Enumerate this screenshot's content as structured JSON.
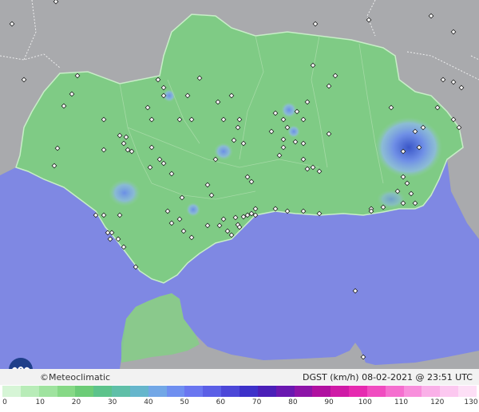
{
  "footer": {
    "copyright": "©Meteoclimatic",
    "product": "DGST (km/h)   08-02-2021 @ 23:51 UTC"
  },
  "scale": {
    "ticks": [
      "0",
      "10",
      "20",
      "30",
      "40",
      "50",
      "60",
      "70",
      "80",
      "90",
      "100",
      "110",
      "120",
      "130"
    ],
    "colors": [
      "#d6f5d6",
      "#b8ecb8",
      "#9fe39f",
      "#86d986",
      "#6ccc77",
      "#5cc38b",
      "#5fbfa8",
      "#66b6cc",
      "#72a7e6",
      "#6f8ff0",
      "#6a76f0",
      "#5b5fe6",
      "#4c47d8",
      "#3d31c9",
      "#4a1fb8",
      "#6a18b0",
      "#8d14a8",
      "#b010a0",
      "#cf1aa6",
      "#e62ab0",
      "#f04cc0",
      "#f56fcf",
      "#f88fdc",
      "#fab0e8",
      "#fcc8f0",
      "#fddff6"
    ]
  },
  "map": {
    "sea_color": "#7f88e3",
    "land_color": "#a9a9ab",
    "wind_base_color": "#7ecb86",
    "station_count": 118
  }
}
